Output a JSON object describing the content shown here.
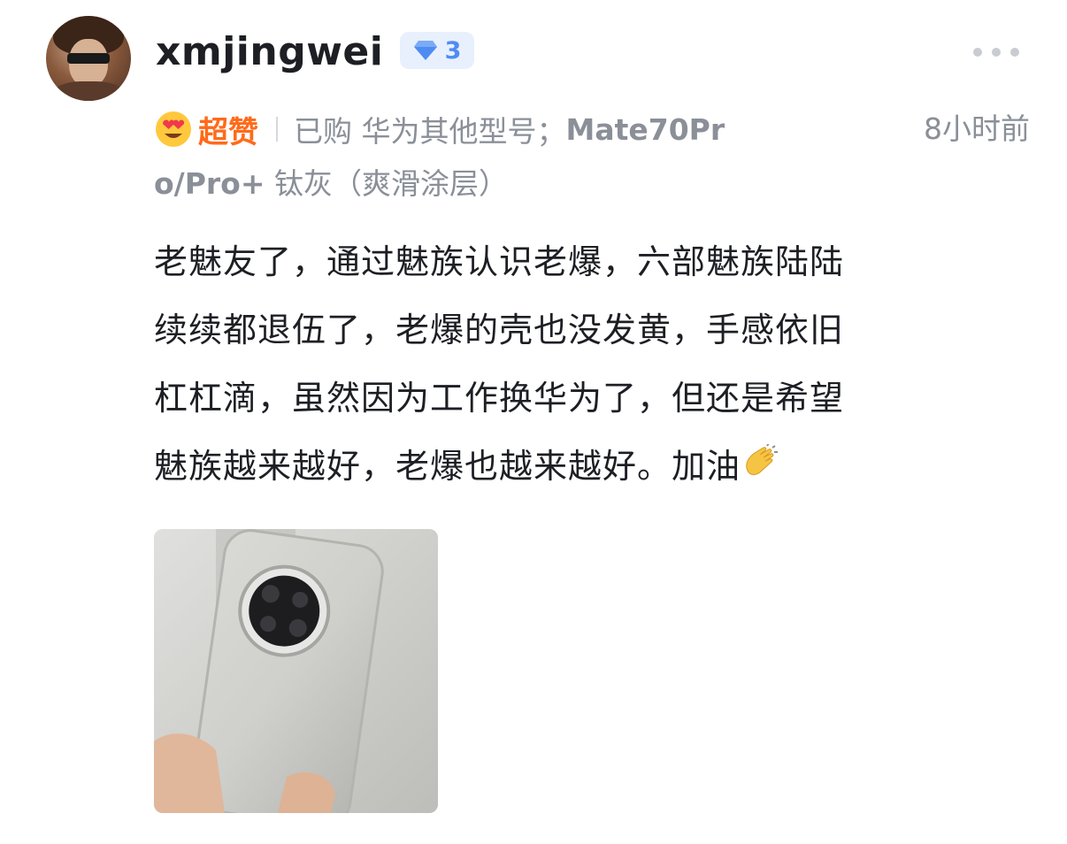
{
  "user": {
    "name": "xmjingwei",
    "level": "3",
    "avatar_icon": "user-avatar"
  },
  "review": {
    "rating_icon": "heart-eyes-emoji-icon",
    "rating_label": "超赞",
    "purchase_prefix": "已购 华为其他型号；",
    "purchase_model_part1": "Mate70Pr",
    "purchase_model_part2": "o/Pro+",
    "purchase_color": " 钛灰（爽滑涂层）",
    "time": "8小时前",
    "text_lines": [
      "老魅友了，通过魅族认识老爆，六部魅族陆陆",
      "续续都退伍了，老爆的壳也没发黄，手感依旧",
      "杠杠滴，虽然因为工作换华为了，但还是希望",
      "魅族越来越好，老爆也越来越好。加油"
    ],
    "end_emoji_icon": "clapping-hands-emoji-icon",
    "photo_icon": "phone-photo"
  },
  "colors": {
    "rating": "#ff6a1a",
    "level_badge": "#4e8cf2",
    "meta_text": "#8a8f98",
    "body_text": "#1d1f24"
  }
}
